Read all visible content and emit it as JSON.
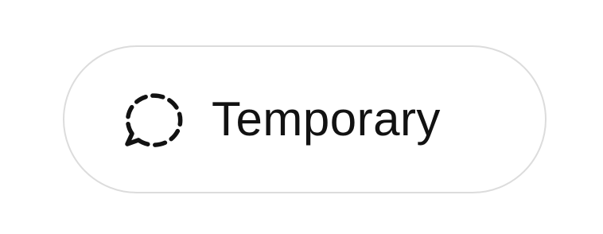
{
  "button": {
    "label": "Temporary",
    "icon": "dashed-chat-bubble-icon"
  },
  "colors": {
    "text": "#121212",
    "border": "#dcdcdc",
    "background": "#ffffff"
  }
}
